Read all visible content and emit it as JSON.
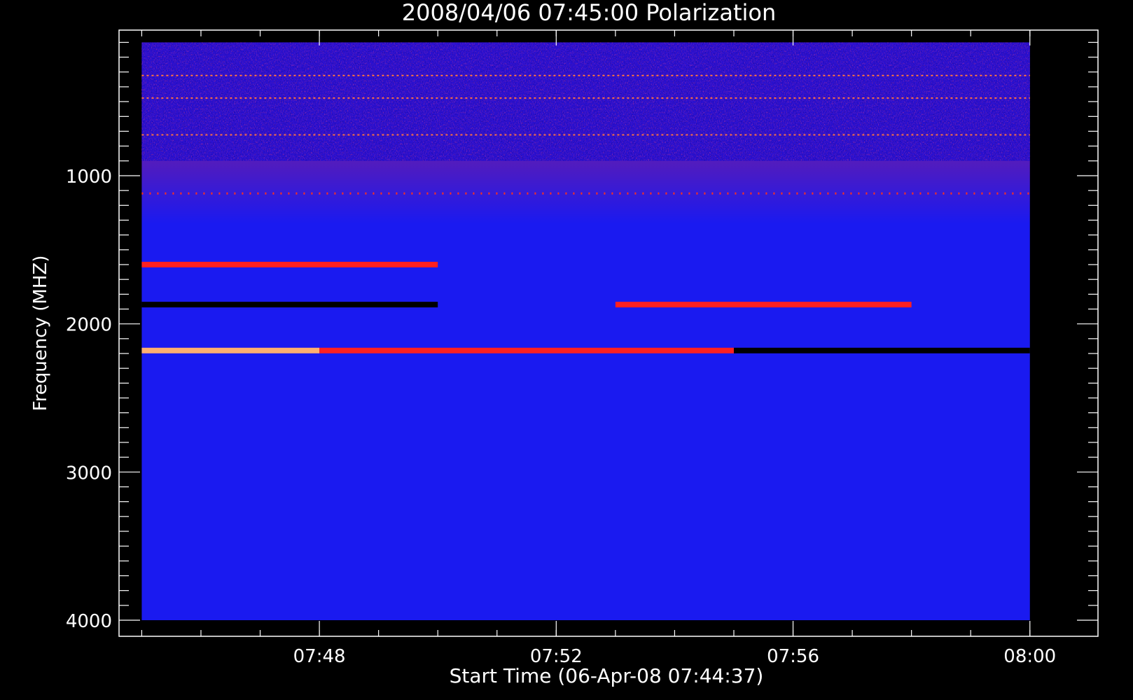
{
  "chart_data": {
    "type": "heatmap",
    "title": "2008/04/06 07:45:00 Polarization",
    "xlabel": "Start Time (06-Apr-08 07:44:37)",
    "ylabel": "Frequency (MHZ)",
    "x_start": "07:45:00",
    "x_end": "08:00:00",
    "xlim": [
      "07:44:37",
      "08:01:09"
    ],
    "ylim": [
      4000,
      0
    ],
    "y_data_range": [
      100,
      4000
    ],
    "x_ticks": [
      "07:48",
      "07:52",
      "07:56",
      "08:00"
    ],
    "y_ticks": [
      1000,
      2000,
      3000,
      4000
    ],
    "colormap": [
      "#000000",
      "#1a00ff",
      "#ff2020",
      "#ffb070"
    ],
    "background_color": "#1a1af0",
    "features": [
      {
        "kind": "noisy-band",
        "freq_range": [
          100,
          900
        ]
      },
      {
        "kind": "dotted-line",
        "freq": 1120,
        "t_range": [
          "07:45:00",
          "08:00:00"
        ]
      },
      {
        "kind": "line",
        "freq": 1600,
        "t_range": [
          "07:45:00",
          "07:50:00"
        ],
        "color": "#ff2020"
      },
      {
        "kind": "line",
        "freq": 1870,
        "t_range": [
          "07:45:00",
          "07:50:00"
        ],
        "color": "#000000"
      },
      {
        "kind": "line",
        "freq": 1870,
        "t_range": [
          "07:53:00",
          "07:58:00"
        ],
        "color": "#ff2020"
      },
      {
        "kind": "line",
        "freq": 2180,
        "t_range": [
          "07:45:00",
          "07:48:00"
        ],
        "color": "#ffb070"
      },
      {
        "kind": "line",
        "freq": 2180,
        "t_range": [
          "07:48:00",
          "07:55:00"
        ],
        "color": "#ff2020"
      },
      {
        "kind": "line",
        "freq": 2180,
        "t_range": [
          "07:55:00",
          "08:00:00"
        ],
        "color": "#000000"
      }
    ]
  }
}
